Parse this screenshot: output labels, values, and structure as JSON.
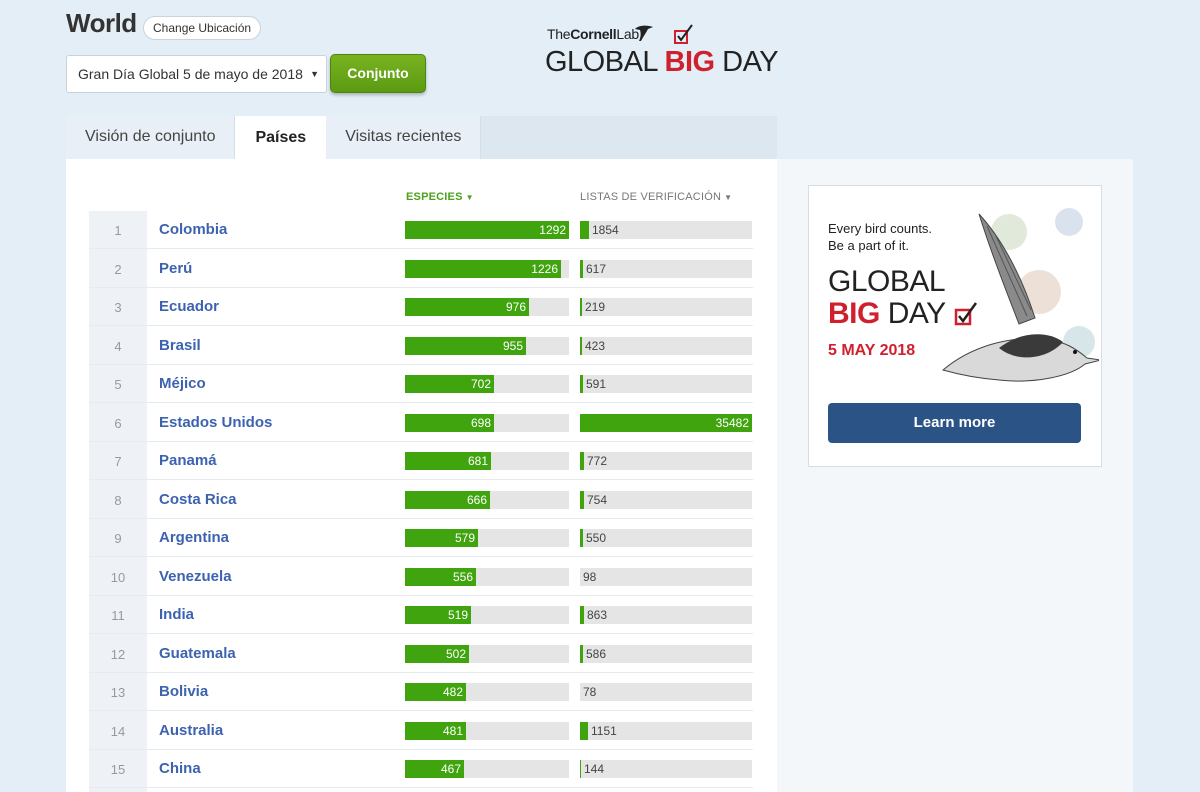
{
  "header": {
    "region": "World",
    "change_location": "Change Ubicación",
    "event_selected": "Gran Día Global 5 de mayo de 2018",
    "go_button": "Conjunto"
  },
  "logo": {
    "lab_prefix": "The",
    "lab_name": "Cornell",
    "lab_suffix": "Lab",
    "word_global": "GLOBAL",
    "word_big": "BIG",
    "word_day": "DAY"
  },
  "tabs": [
    {
      "label": "Visión de conjunto"
    },
    {
      "label": "Países"
    },
    {
      "label": "Visitas recientes"
    }
  ],
  "table": {
    "col_species": "ESPECIES",
    "col_checklists": "LISTAS DE VERIFICACIÓN",
    "species_max": 1292,
    "checklists_max": 35482,
    "rows": [
      {
        "rank": "1",
        "country": "Colombia",
        "species": 1292,
        "checklists": 1854
      },
      {
        "rank": "2",
        "country": "Perú",
        "species": 1226,
        "checklists": 617
      },
      {
        "rank": "3",
        "country": "Ecuador",
        "species": 976,
        "checklists": 219
      },
      {
        "rank": "4",
        "country": "Brasil",
        "species": 955,
        "checklists": 423
      },
      {
        "rank": "5",
        "country": "Méjico",
        "species": 702,
        "checklists": 591
      },
      {
        "rank": "6",
        "country": "Estados Unidos",
        "species": 698,
        "checklists": 35482
      },
      {
        "rank": "7",
        "country": "Panamá",
        "species": 681,
        "checklists": 772
      },
      {
        "rank": "8",
        "country": "Costa Rica",
        "species": 666,
        "checklists": 754
      },
      {
        "rank": "9",
        "country": "Argentina",
        "species": 579,
        "checklists": 550
      },
      {
        "rank": "10",
        "country": "Venezuela",
        "species": 556,
        "checklists": 98
      },
      {
        "rank": "11",
        "country": "India",
        "species": 519,
        "checklists": 863
      },
      {
        "rank": "12",
        "country": "Guatemala",
        "species": 502,
        "checklists": 586
      },
      {
        "rank": "13",
        "country": "Bolivia",
        "species": 482,
        "checklists": 78
      },
      {
        "rank": "14",
        "country": "Australia",
        "species": 481,
        "checklists": 1151
      },
      {
        "rank": "15",
        "country": "China",
        "species": 467,
        "checklists": 144
      }
    ]
  },
  "ad": {
    "tagline_1": "Every bird counts.",
    "tagline_2": "Be a part of it.",
    "word_global": "GLOBAL",
    "word_big": "BIG",
    "word_day": "DAY",
    "date": "5 MAY 2018",
    "button": "Learn more"
  },
  "colors": {
    "bar_green": "#40a40e",
    "link_blue": "#3d62b0",
    "brand_red": "#d0202e",
    "ad_button": "#2c5386"
  }
}
